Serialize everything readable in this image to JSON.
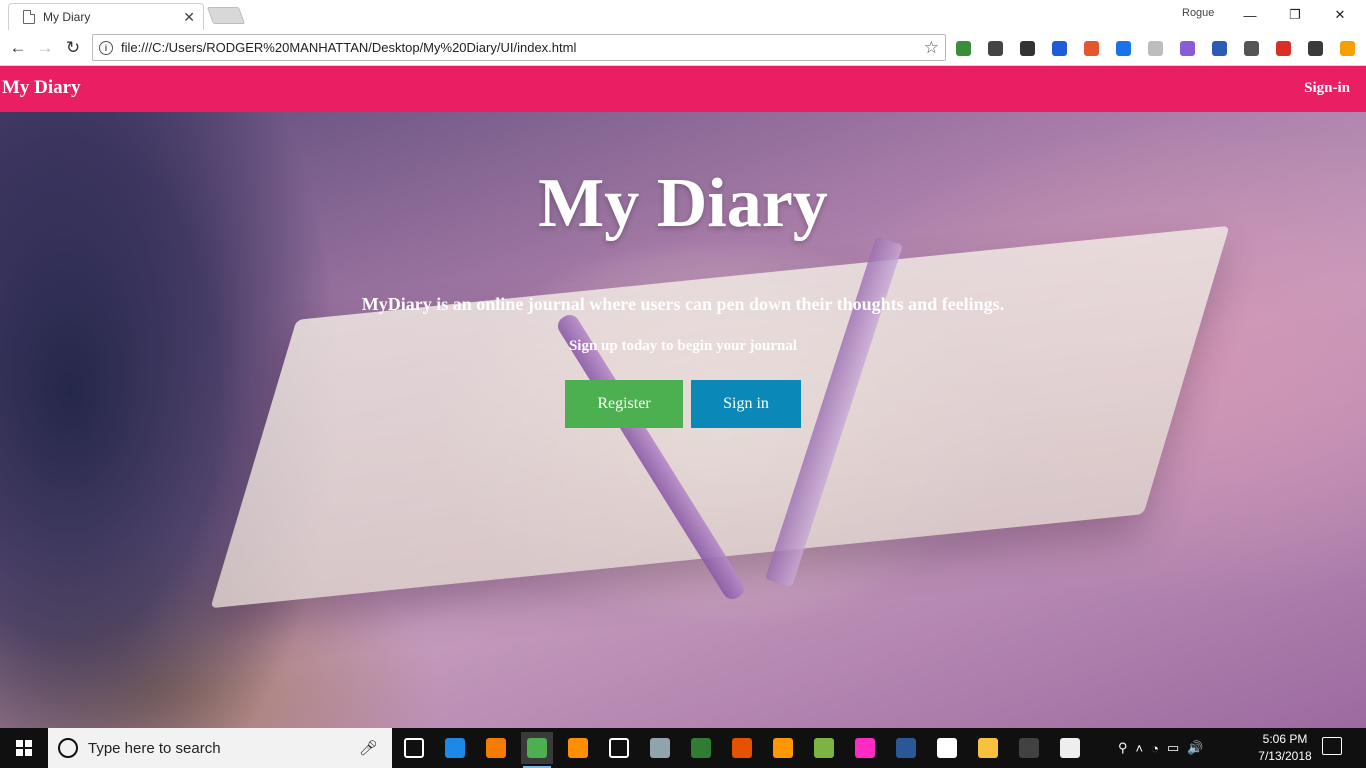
{
  "browser": {
    "tab_title": "My Diary",
    "tab_close": "✕",
    "profile_name": "Rogue",
    "url": "file:///C:/Users/RODGER%20MANHATTAN/Desktop/My%20Diary/UI/index.html",
    "window_controls": {
      "minimize": "—",
      "restore": "❐",
      "close": "✕"
    },
    "nav": {
      "back": "←",
      "forward": "→",
      "reload": "↻"
    },
    "star": "☆",
    "info": "i",
    "extensions": [
      {
        "name": "globe-extension-icon",
        "color": "#3a8d3a"
      },
      {
        "name": "car-extension-icon",
        "color": "#444444"
      },
      {
        "name": "puzzle-extension-icon",
        "color": "#333333"
      },
      {
        "name": "gmail-extension-icon",
        "color": "#1e5bd6"
      },
      {
        "name": "blocker-extension-icon",
        "color": "#e4572e"
      },
      {
        "name": "window-extension-icon",
        "color": "#1a73e8"
      },
      {
        "name": "m-extension-icon",
        "color": "#bdbdbd"
      },
      {
        "name": "file-extension-icon",
        "color": "#8a5bd6"
      },
      {
        "name": "download-manager-extension-icon",
        "color": "#2a5bb5"
      },
      {
        "name": "camera-extension-icon",
        "color": "#555555"
      },
      {
        "name": "flag-extension-icon",
        "color": "#d93025"
      },
      {
        "name": "download-extension-icon",
        "color": "#3a3a3a"
      },
      {
        "name": "alert-extension-icon",
        "color": "#f4a000"
      }
    ]
  },
  "site": {
    "brand": "My Diary",
    "nav_signin": "Sign-in",
    "accent_color": "#e91e63"
  },
  "hero": {
    "title": "My Diary",
    "lead": "MyDiary is an online journal where users can pen down their thoughts and feelings.",
    "sub": "Sign up today to begin your journal",
    "register_label": "Register",
    "signin_label": "Sign in",
    "register_color": "#4caf50",
    "signin_color": "#0a88b8"
  },
  "taskbar": {
    "search_placeholder": "Type here to search",
    "apps": [
      {
        "name": "task-view-icon",
        "color": "#101010"
      },
      {
        "name": "edge-icon",
        "color": "#1e88e5"
      },
      {
        "name": "search-app-icon",
        "color": "#f57c00"
      },
      {
        "name": "chrome-icon",
        "color": "#4caf50",
        "active": true
      },
      {
        "name": "vlc-icon",
        "color": "#ff8f00"
      },
      {
        "name": "settings-icon",
        "color": "#101010"
      },
      {
        "name": "screen-icon",
        "color": "#90a4ae"
      },
      {
        "name": "network-icon",
        "color": "#2e7d32"
      },
      {
        "name": "git-icon",
        "color": "#e65100"
      },
      {
        "name": "sublime-icon",
        "color": "#ff9800"
      },
      {
        "name": "chameleon-icon",
        "color": "#7cb342"
      },
      {
        "name": "adobe-xd-icon",
        "color": "#ff2bc2"
      },
      {
        "name": "word-icon",
        "color": "#2b5797"
      },
      {
        "name": "photos-icon",
        "color": "#ffffff"
      },
      {
        "name": "file-explorer-icon",
        "color": "#f9c23c"
      },
      {
        "name": "terminal-icon",
        "color": "#424242"
      },
      {
        "name": "devices-icon",
        "color": "#eeeeee"
      }
    ],
    "tray_icons": [
      "⚲",
      "˄",
      "◔",
      "▭",
      "🔊"
    ],
    "time": "5:06 PM",
    "date": "7/13/2018"
  }
}
